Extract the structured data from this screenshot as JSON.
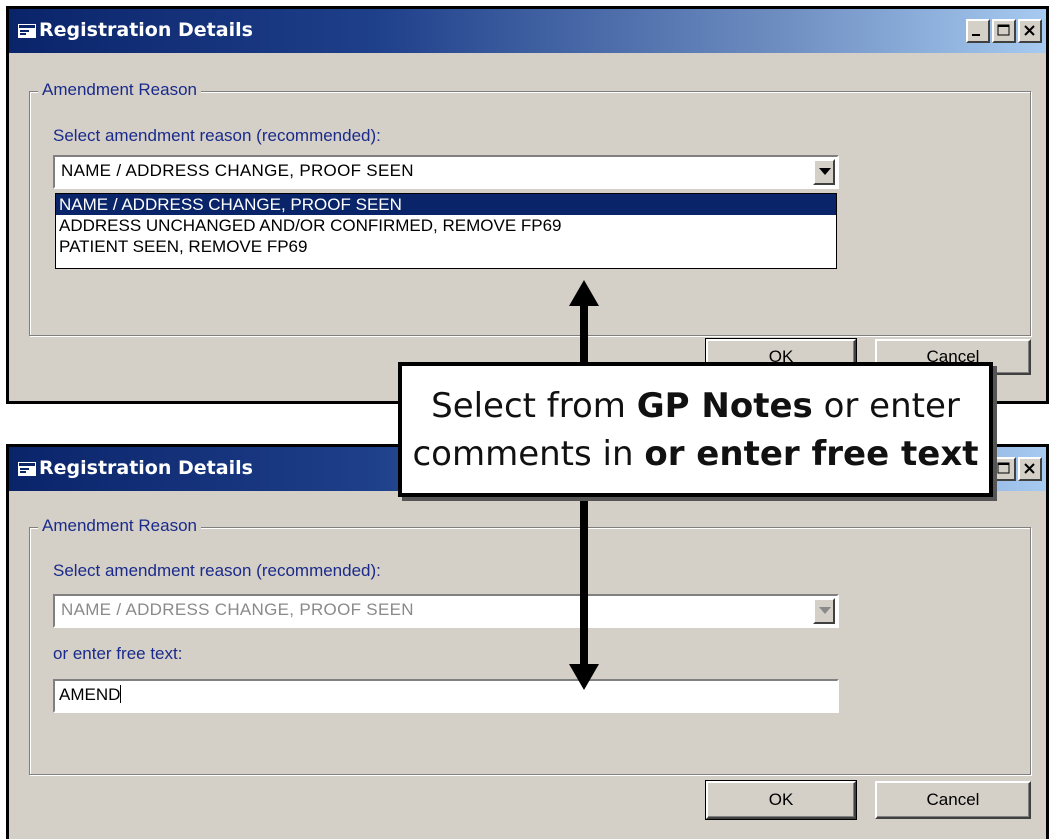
{
  "top_window": {
    "title": "Registration Details",
    "group_label": "Amendment Reason",
    "select_label": "Select amendment reason (recommended):",
    "combo_value": "NAME / ADDRESS CHANGE, PROOF SEEN",
    "dropdown_options": [
      "NAME / ADDRESS CHANGE, PROOF SEEN",
      "ADDRESS UNCHANGED AND/OR CONFIRMED, REMOVE FP69",
      "PATIENT SEEN, REMOVE FP69"
    ],
    "selected_option_index": 0,
    "ok_label": "OK",
    "cancel_label": "Cancel"
  },
  "bottom_window": {
    "title": "Registration Details",
    "group_label": "Amendment Reason",
    "select_label": "Select amendment reason (recommended):",
    "combo_value": "NAME / ADDRESS CHANGE, PROOF SEEN",
    "free_text_label": "or enter free text:",
    "free_text_value": "AMEND",
    "ok_label": "OK",
    "cancel_label": "Cancel"
  },
  "callout": {
    "line1_pre": "Select from ",
    "line1_bold": "GP Notes",
    "line1_post": " or enter",
    "line2_pre": "comments in ",
    "line2_bold": "or enter free text"
  },
  "colors": {
    "titlebar_start": "#0a246a",
    "titlebar_end": "#a6caf0",
    "dialog_bg": "#d4d0c8",
    "label_text": "#1a2a8a",
    "selection": "#0a246a"
  },
  "icons": {
    "window_icon": "app-window-icon",
    "minimize": "minimize-icon",
    "maximize": "maximize-icon",
    "close": "close-icon",
    "dropdown": "chevron-down-icon",
    "arrow_up": "arrow-up-icon",
    "arrow_down": "arrow-down-icon"
  }
}
